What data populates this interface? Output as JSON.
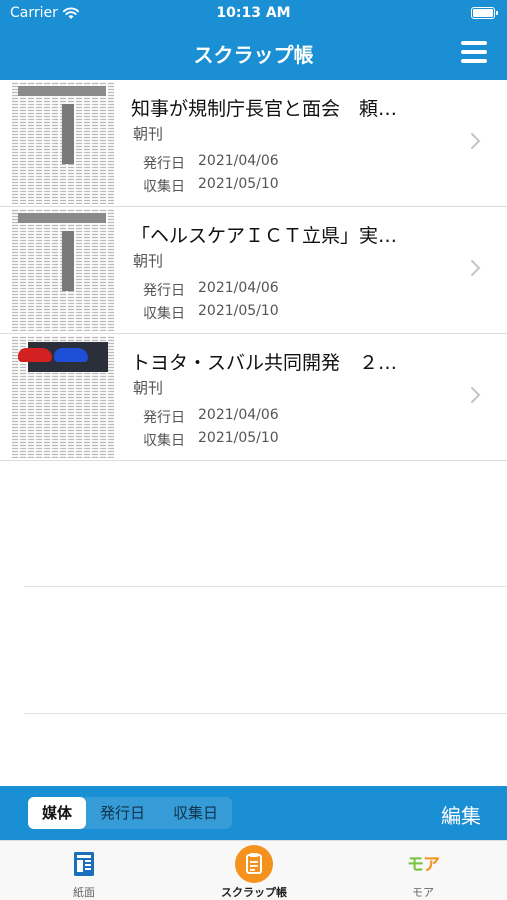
{
  "status_bar": {
    "carrier": "Carrier",
    "time": "10:13 AM",
    "battery_level": 1.0
  },
  "nav": {
    "title": "スクラップ帳"
  },
  "articles": [
    {
      "headline": "知事が規制庁長官と面会　頼…",
      "media": "朝刊",
      "issued_label": "発行日",
      "issued": "2021/04/06",
      "collected_label": "収集日",
      "collected": "2021/05/10"
    },
    {
      "headline": "「ヘルスケアＩＣＴ立県」実…",
      "media": "朝刊",
      "issued_label": "発行日",
      "issued": "2021/04/06",
      "collected_label": "収集日",
      "collected": "2021/05/10"
    },
    {
      "headline": "トヨタ・スバル共同開発　２…",
      "media": "朝刊",
      "issued_label": "発行日",
      "issued": "2021/04/06",
      "collected_label": "収集日",
      "collected": "2021/05/10"
    }
  ],
  "sort": {
    "options": [
      "媒体",
      "発行日",
      "収集日"
    ],
    "selected": "媒体",
    "edit_label": "編集"
  },
  "tabs": [
    {
      "label": "紙面",
      "icon": "newspaper-icon"
    },
    {
      "label": "スクラップ帳",
      "icon": "clipboard-icon",
      "active": true
    },
    {
      "label": "モア",
      "icon": "more-logo-icon"
    }
  ],
  "colors": {
    "primary": "#1a8fd3",
    "accent": "#f5921e"
  }
}
